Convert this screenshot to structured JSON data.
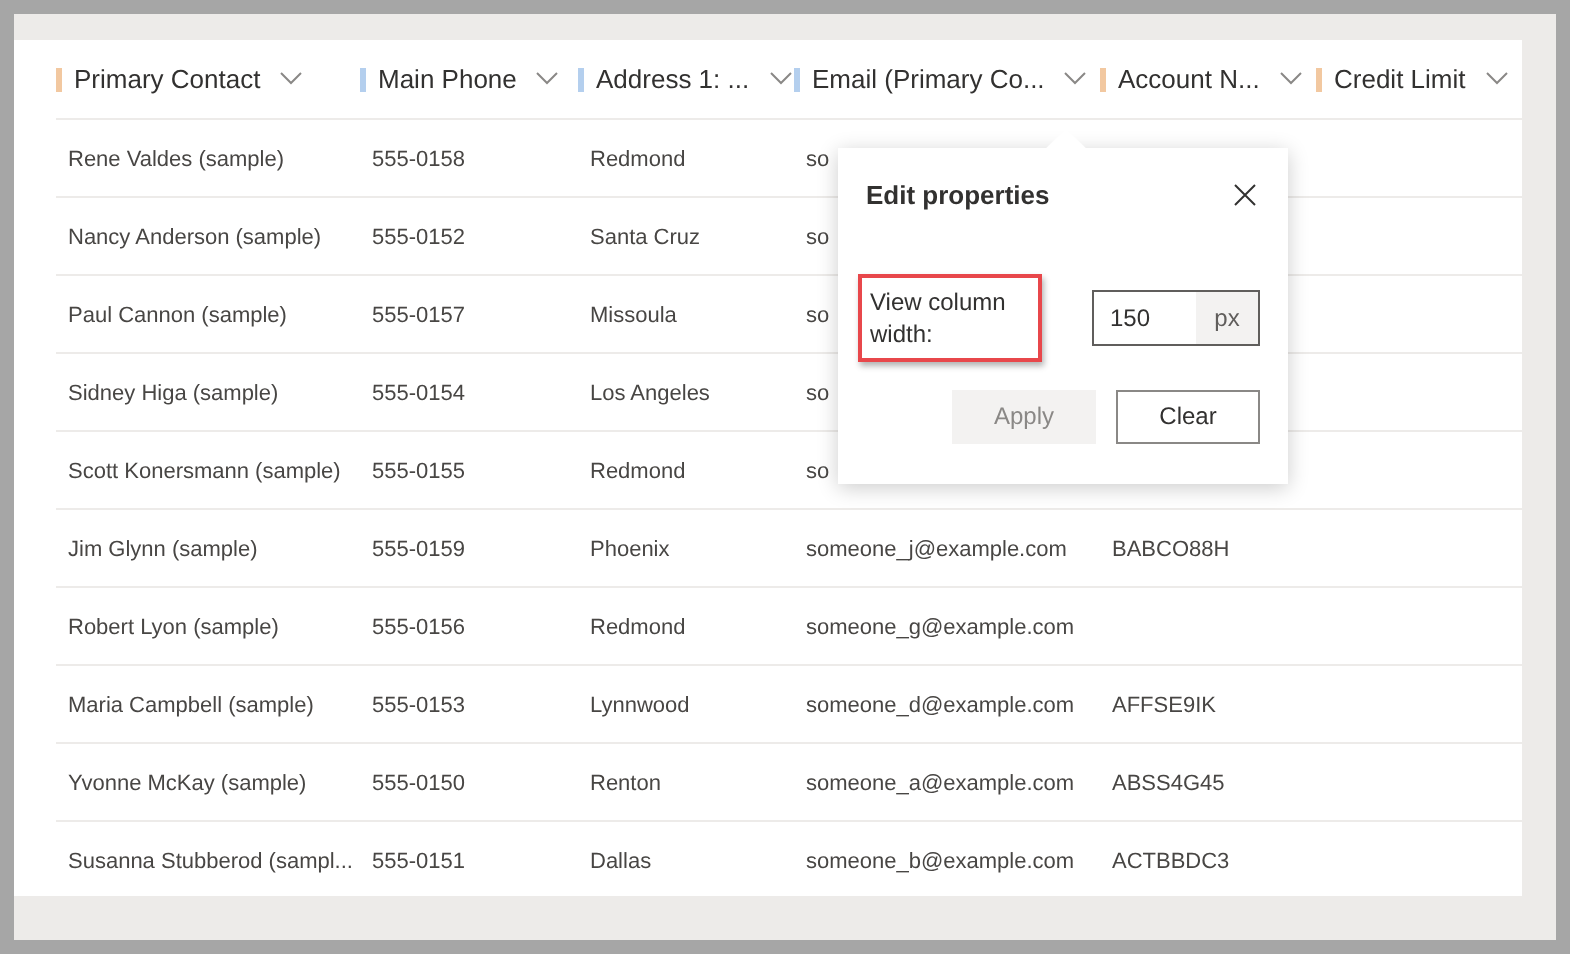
{
  "table": {
    "columns": [
      {
        "label": "Primary Contact",
        "color": "#f2c8a0"
      },
      {
        "label": "Main Phone",
        "color": "#b4cfee"
      },
      {
        "label": "Address 1: ...",
        "color": "#b4cfee"
      },
      {
        "label": "Email (Primary Co...",
        "color": "#b4cfee"
      },
      {
        "label": "Account N...",
        "color": "#f2c8a0"
      },
      {
        "label": "Credit Limit",
        "color": "#f2c8a0"
      }
    ],
    "rows": [
      [
        "Rene Valdes (sample)",
        "555-0158",
        "Redmond",
        "so",
        ""
      ],
      [
        "Nancy Anderson (sample)",
        "555-0152",
        "Santa Cruz",
        "so",
        ""
      ],
      [
        "Paul Cannon (sample)",
        "555-0157",
        "Missoula",
        "so",
        ""
      ],
      [
        "Sidney Higa (sample)",
        "555-0154",
        "Los Angeles",
        "so",
        ""
      ],
      [
        "Scott Konersmann (sample)",
        "555-0155",
        "Redmond",
        "so",
        ""
      ],
      [
        "Jim Glynn (sample)",
        "555-0159",
        "Phoenix",
        "someone_j@example.com",
        "BABCO88H"
      ],
      [
        "Robert Lyon (sample)",
        "555-0156",
        "Redmond",
        "someone_g@example.com",
        ""
      ],
      [
        "Maria Campbell (sample)",
        "555-0153",
        "Lynnwood",
        "someone_d@example.com",
        "AFFSE9IK"
      ],
      [
        "Yvonne McKay (sample)",
        "555-0150",
        "Renton",
        "someone_a@example.com",
        "ABSS4G45"
      ],
      [
        "Susanna Stubberod (sampl...",
        "555-0151",
        "Dallas",
        "someone_b@example.com",
        "ACTBBDC3"
      ]
    ]
  },
  "popup": {
    "title": "Edit properties",
    "field_label": "View column width:",
    "field_highlighted": true,
    "value": "150",
    "unit": "px",
    "buttons": [
      {
        "label": "Apply",
        "disabled": true
      },
      {
        "label": "Clear",
        "disabled": false
      }
    ]
  }
}
